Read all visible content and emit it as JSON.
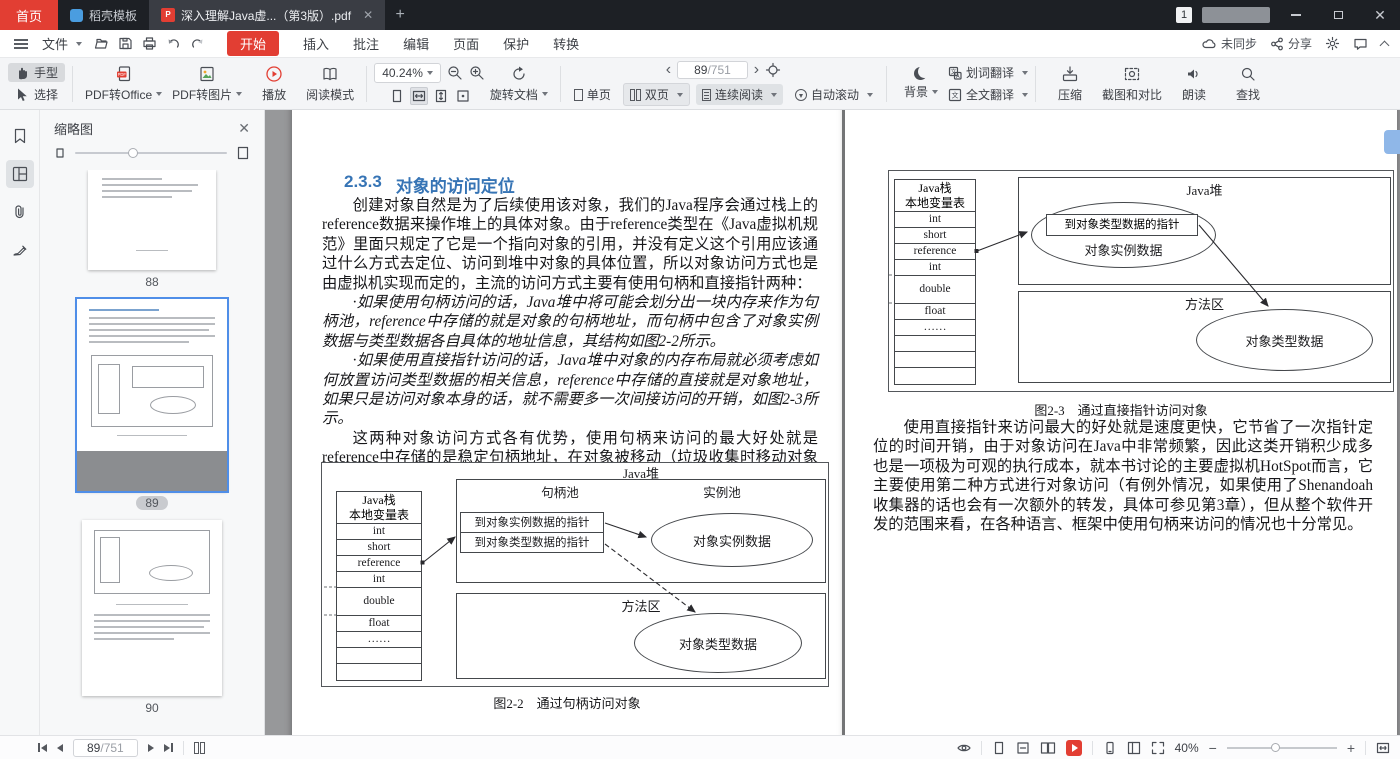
{
  "titlebar": {
    "home": "首页",
    "template_tab": "稻壳模板",
    "doc_tab": "深入理解Java虚...（第3版）.pdf",
    "badge": "1"
  },
  "menubar": {
    "file": "文件",
    "tabs": [
      "开始",
      "插入",
      "批注",
      "编辑",
      "页面",
      "保护",
      "转换"
    ],
    "sync": "未同步",
    "share": "分享"
  },
  "toolbar": {
    "hand": "手型",
    "select": "选择",
    "pdf_to_office": "PDF转Office",
    "pdf_to_image": "PDF转图片",
    "play": "播放",
    "read_mode": "阅读模式",
    "zoom": "40.24%",
    "rotate_doc": "旋转文档",
    "page_num": "89",
    "page_total": "/751",
    "view_single": "单页",
    "view_double": "双页",
    "view_continuous": "连续阅读",
    "view_autoscroll": "自动滚动",
    "background": "背景",
    "word_translate": "划词翻译",
    "full_translate": "全文翻译",
    "compress": "压缩",
    "screenshot_compare": "截图和对比",
    "read_aloud": "朗读",
    "find": "查找"
  },
  "sidebar": {
    "title": "缩略图",
    "thumb_labels": [
      "88",
      "89",
      "90"
    ]
  },
  "page_left": {
    "heading_no": "2.3.3",
    "heading": "对象的访问定位",
    "p1": "创建对象自然是为了后续使用该对象，我们的Java程序会通过栈上的reference数据来操作堆上的具体对象。由于reference类型在《Java虚拟机规范》里面只规定了它是一个指向对象的引用，并没有定义这个引用应该通过什么方式去定位、访问到堆中对象的具体位置，所以对象访问方式也是由虚拟机实现而定的，主流的访问方式主要有使用句柄和直接指针两种：",
    "p2": "·如果使用句柄访问的话，Java堆中将可能会划分出一块内存来作为句柄池，reference中存储的就是对象的句柄地址，而句柄中包含了对象实例数据与类型数据各自具体的地址信息，其结构如图2-2所示。",
    "p3": "·如果使用直接指针访问的话，Java堆中对象的内存布局就必须考虑如何放置访问类型数据的相关信息，reference中存储的直接就是对象地址，如果只是访问对象本身的话，就不需要多一次间接访问的开销，如图2-3所示。",
    "p4": "这两种对象访问方式各有优势，使用句柄来访问的最大好处就是reference中存储的是稳定句柄地址，在对象被移动（垃圾收集时移动对象是非常普遍的行为）时只会改变句柄中的实例数据指针，而reference本身不需要被修改。",
    "fig": {
      "stack_title1": "Java栈",
      "stack_title2": "本地变量表",
      "rows": [
        "int",
        "short",
        "reference",
        "int",
        "double",
        "float",
        "……"
      ],
      "heap": "Java堆",
      "handle_pool": "句柄池",
      "instance_pool": "实例池",
      "ptr_instance": "到对象实例数据的指针",
      "ptr_type": "到对象类型数据的指针",
      "instance_data": "对象实例数据",
      "method_area": "方法区",
      "type_data": "对象类型数据",
      "caption": "图2-2　通过句柄访问对象"
    }
  },
  "page_right": {
    "fig": {
      "stack_title1": "Java栈",
      "stack_title2": "本地变量表",
      "rows": [
        "int",
        "short",
        "reference",
        "int",
        "double",
        "float",
        "……"
      ],
      "heap": "Java堆",
      "ptr_type": "到对象类型数据的指针",
      "instance_data": "对象实例数据",
      "method_area": "方法区",
      "type_data": "对象类型数据",
      "caption": "图2-3　通过直接指针访问对象"
    },
    "p1": "使用直接指针来访问最大的好处就是速度更快，它节省了一次指针定位的时间开销，由于对象访问在Java中非常频繁，因此这类开销积少成多也是一项极为可观的执行成本，就本书讨论的主要虚拟机HotSpot而言，它主要使用第二种方式进行对象访问（有例外情况，如果使用了Shenandoah收集器的话也会有一次额外的转发，具体可参见第3章），但从整个软件开发的范围来看，在各种语言、框架中使用句柄来访问的情况也十分常见。"
  },
  "statusbar": {
    "page_num": "89",
    "page_total": "/751",
    "zoom": "40%"
  }
}
